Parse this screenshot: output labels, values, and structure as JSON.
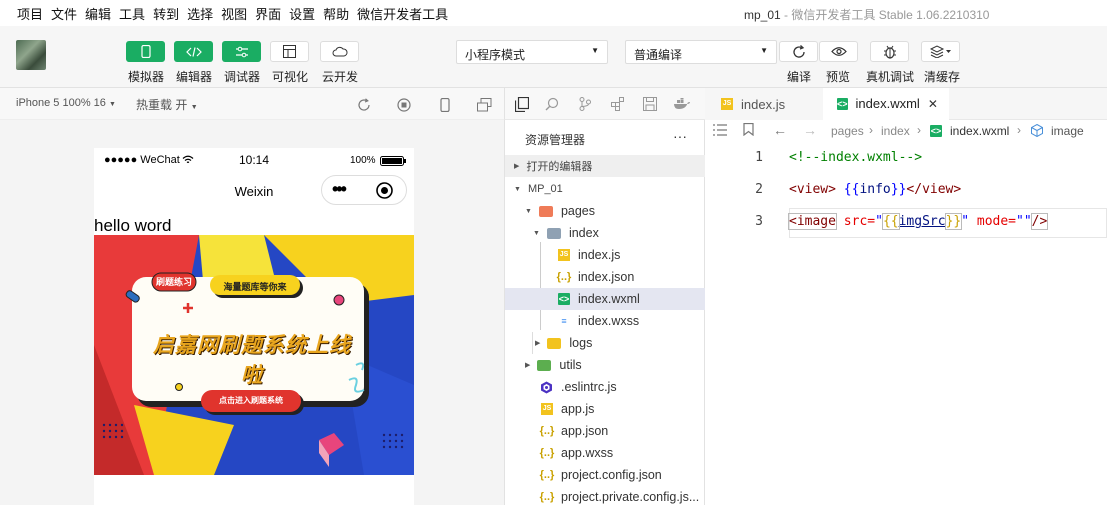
{
  "menubar": {
    "items": [
      "项目",
      "文件",
      "编辑",
      "工具",
      "转到",
      "选择",
      "视图",
      "界面",
      "设置",
      "帮助",
      "微信开发者工具"
    ],
    "window_title": "mp_01",
    "window_subtitle": "- 微信开发者工具 Stable 1.06.2210310"
  },
  "toolbar": {
    "simulator_label": "模拟器",
    "editor_label": "编辑器",
    "debugger_label": "调试器",
    "visual_label": "可视化",
    "cloud_label": "云开发",
    "mode_select": "小程序模式",
    "compile_select": "普通编译",
    "compile_label": "编译",
    "preview_label": "预览",
    "realdebug_label": "真机调试",
    "clearcache_label": "清缓存"
  },
  "simulator": {
    "device": "iPhone 5 100% 16",
    "hotreload": "热重载 开",
    "status_carrier": "●●●●● WeChat",
    "status_time": "10:14",
    "status_battery": "100%",
    "nav_title": "Weixin",
    "capsule_dots": "•••",
    "page_text": "hello word"
  },
  "banner": {
    "tag_left": "刷题练习",
    "tag_top": "海量题库等你来",
    "headline": "启嘉网刷题系统上线啦",
    "cta": "点击进入刷题系统"
  },
  "explorer": {
    "title": "资源管理器",
    "more": "···",
    "open_editors": "打开的编辑器",
    "project": "MP_01",
    "items": [
      {
        "label": "pages"
      },
      {
        "label": "index"
      },
      {
        "label": "index.js"
      },
      {
        "label": "index.json"
      },
      {
        "label": "index.wxml"
      },
      {
        "label": "index.wxss"
      },
      {
        "label": "logs"
      },
      {
        "label": "utils"
      },
      {
        "label": ".eslintrc.js"
      },
      {
        "label": "app.js"
      },
      {
        "label": "app.json"
      },
      {
        "label": "app.wxss"
      },
      {
        "label": "project.config.json"
      },
      {
        "label": "project.private.config.js..."
      }
    ]
  },
  "editor": {
    "tabs": [
      {
        "label": "index.js"
      },
      {
        "label": "index.wxml"
      }
    ],
    "close_glyph": "✕",
    "breadcrumb": {
      "pages": "pages",
      "index": "index",
      "file": "index.wxml",
      "node": "image",
      "sep": "›"
    },
    "line_numbers": [
      "1",
      "2",
      "3"
    ],
    "code": {
      "l1": "<!--index.wxml-->",
      "l2_open": "<view>",
      "l2_b1": "{{",
      "l2_var": "info",
      "l2_b2": "}}",
      "l2_close": "</view>",
      "l3_tag": "<image",
      "l3_attr1": " src=",
      "l3_q1": "\"",
      "l3_b1": "{{",
      "l3_var": "imgSrc",
      "l3_b2": "}}",
      "l3_q2": "\"",
      "l3_attr2": " mode=",
      "l3_val2": "\"\"",
      "l3_end": "/>"
    }
  },
  "colors": {
    "green": "#1aad63",
    "code_tag": "#800000",
    "code_attr": "#e50000",
    "code_string": "#0000ff",
    "code_comment": "#008000"
  }
}
